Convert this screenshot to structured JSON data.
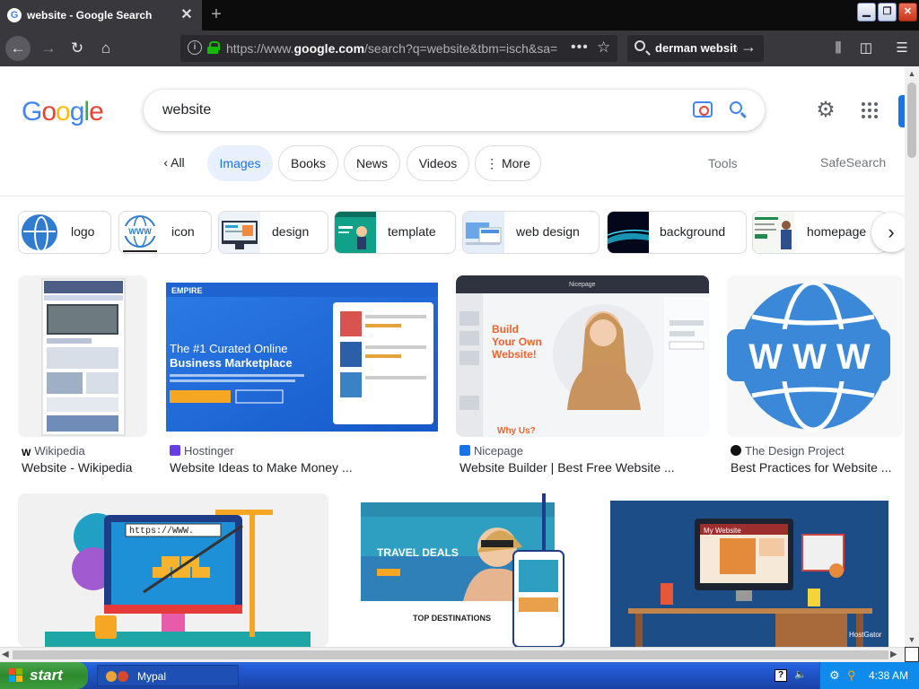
{
  "browser": {
    "tab": {
      "title": "website - Google Search"
    },
    "new_tab_symbol": "+",
    "window_buttons": {
      "minimize": "▁",
      "maximize": "❐",
      "close": "✕"
    },
    "url": {
      "prefix": "https://www.",
      "domain": "google.com",
      "rest": "/search?q=website&tbm=isch&sa="
    },
    "search_bar": {
      "text": "derman website"
    },
    "icons": [
      "back-arrow",
      "forward-arrow",
      "reload",
      "home",
      "info",
      "lock",
      "page-actions",
      "bookmark-star",
      "library",
      "sidebar",
      "hamburger-menu"
    ]
  },
  "google": {
    "logo": [
      "G",
      "o",
      "o",
      "g",
      "l",
      "e"
    ],
    "query": "website",
    "filters": [
      {
        "label": "All",
        "active": false
      },
      {
        "label": "Images",
        "active": true
      },
      {
        "label": "Books",
        "active": false
      },
      {
        "label": "News",
        "active": false
      },
      {
        "label": "Videos",
        "active": false
      },
      {
        "label": "More",
        "active": false
      }
    ],
    "tools": "Tools",
    "safesearch": "SafeSearch",
    "related_chips": [
      "logo",
      "icon",
      "design",
      "template",
      "web design",
      "background",
      "homepage"
    ],
    "results": [
      {
        "source": "Wikipedia",
        "title": "Website - Wikipedia"
      },
      {
        "source": "Hostinger",
        "title": "Website Ideas to Make Money ..."
      },
      {
        "source": "Nicepage",
        "title": "Website Builder | Best Free Website ..."
      },
      {
        "source": "The Design Project",
        "title": "Best Practices for Website ..."
      }
    ],
    "image_texts": {
      "hostinger_headline_1": "The #1 Curated Online",
      "hostinger_headline_2": "Business Marketplace",
      "hostinger_brand": "EMPIRE",
      "nicepage_title": "Nicepage",
      "nicepage_line_1": "Build",
      "nicepage_line_2": "Your Own",
      "nicepage_line_3": "Website!",
      "nicepage_why": "Why Us?",
      "www": "W W W",
      "url_bar_text": "https://WWW.",
      "travel_deals": "TRAVEL DEALS",
      "top_destinations": "TOP DESTINATIONS",
      "my_website": "My Website",
      "hostgator": "HostGator"
    }
  },
  "taskbar": {
    "start": "start",
    "task": "Mypal",
    "clock": "4:38 AM",
    "help": "?"
  },
  "colors": {
    "google_blue": "#4285f4",
    "google_red": "#ea4335",
    "google_yellow": "#fbbc05",
    "google_green": "#34a853",
    "active_filter_bg": "#e8f0fe",
    "browser_chrome": "#38383d"
  }
}
